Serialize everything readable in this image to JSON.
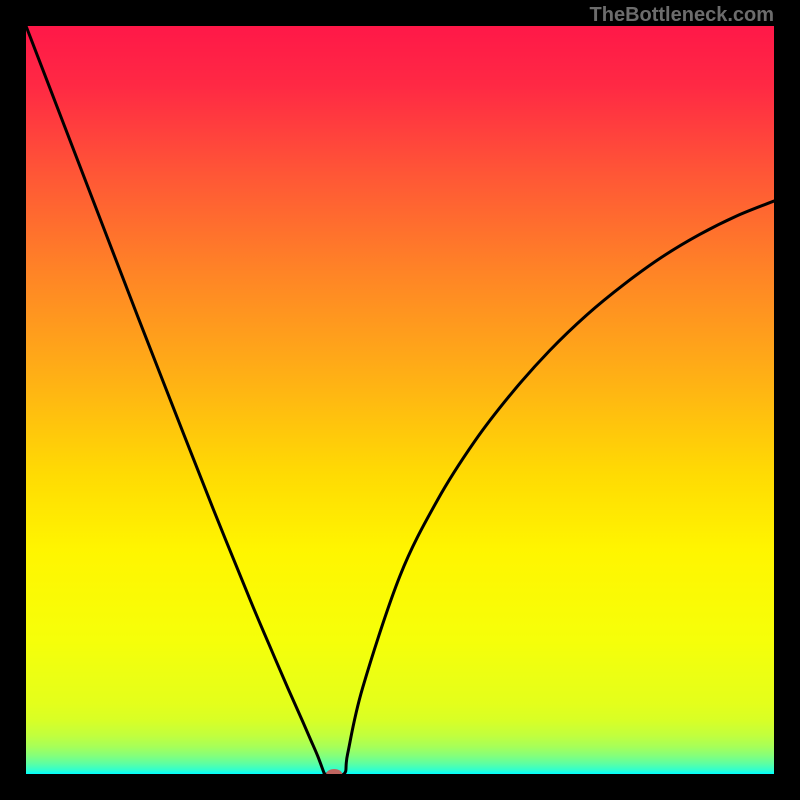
{
  "watermark": "TheBottleneck.com",
  "chart_data": {
    "type": "line",
    "title": "",
    "xlabel": "",
    "ylabel": "",
    "xlim": [
      0,
      100
    ],
    "ylim": [
      0,
      100
    ],
    "x": [
      0,
      5,
      10,
      15,
      20,
      25,
      30,
      32.5,
      35,
      37,
      38,
      39,
      39.9,
      40,
      42.5,
      43,
      45,
      50,
      55,
      60,
      65,
      70,
      75,
      80,
      85,
      90,
      95,
      100
    ],
    "y": [
      100,
      87,
      74,
      61,
      48.2,
      35.5,
      23.2,
      17.3,
      11.5,
      7,
      4.7,
      2.4,
      0,
      0,
      0,
      2.7,
      11.5,
      26.5,
      36.6,
      44.5,
      51,
      56.6,
      61.4,
      65.5,
      69.1,
      72.1,
      74.6,
      76.6
    ],
    "optimal_marker": {
      "x": 41.2,
      "y": 0
    },
    "gradient_stops": [
      {
        "offset": 0.0,
        "color": "#ff1848"
      },
      {
        "offset": 0.08,
        "color": "#ff2944"
      },
      {
        "offset": 0.2,
        "color": "#ff5736"
      },
      {
        "offset": 0.33,
        "color": "#ff8426"
      },
      {
        "offset": 0.47,
        "color": "#ffb015"
      },
      {
        "offset": 0.6,
        "color": "#ffdb03"
      },
      {
        "offset": 0.7,
        "color": "#fff500"
      },
      {
        "offset": 0.82,
        "color": "#f6ff09"
      },
      {
        "offset": 0.905,
        "color": "#e4ff1b"
      },
      {
        "offset": 0.927,
        "color": "#d9ff25"
      },
      {
        "offset": 0.948,
        "color": "#c2ff3d"
      },
      {
        "offset": 0.963,
        "color": "#a7ff58"
      },
      {
        "offset": 0.975,
        "color": "#86ff79"
      },
      {
        "offset": 0.986,
        "color": "#5dffa2"
      },
      {
        "offset": 0.995,
        "color": "#2fffd0"
      },
      {
        "offset": 1.0,
        "color": "#00ffff"
      }
    ],
    "marker_color": "#bf6560",
    "curve_color": "#000000"
  }
}
